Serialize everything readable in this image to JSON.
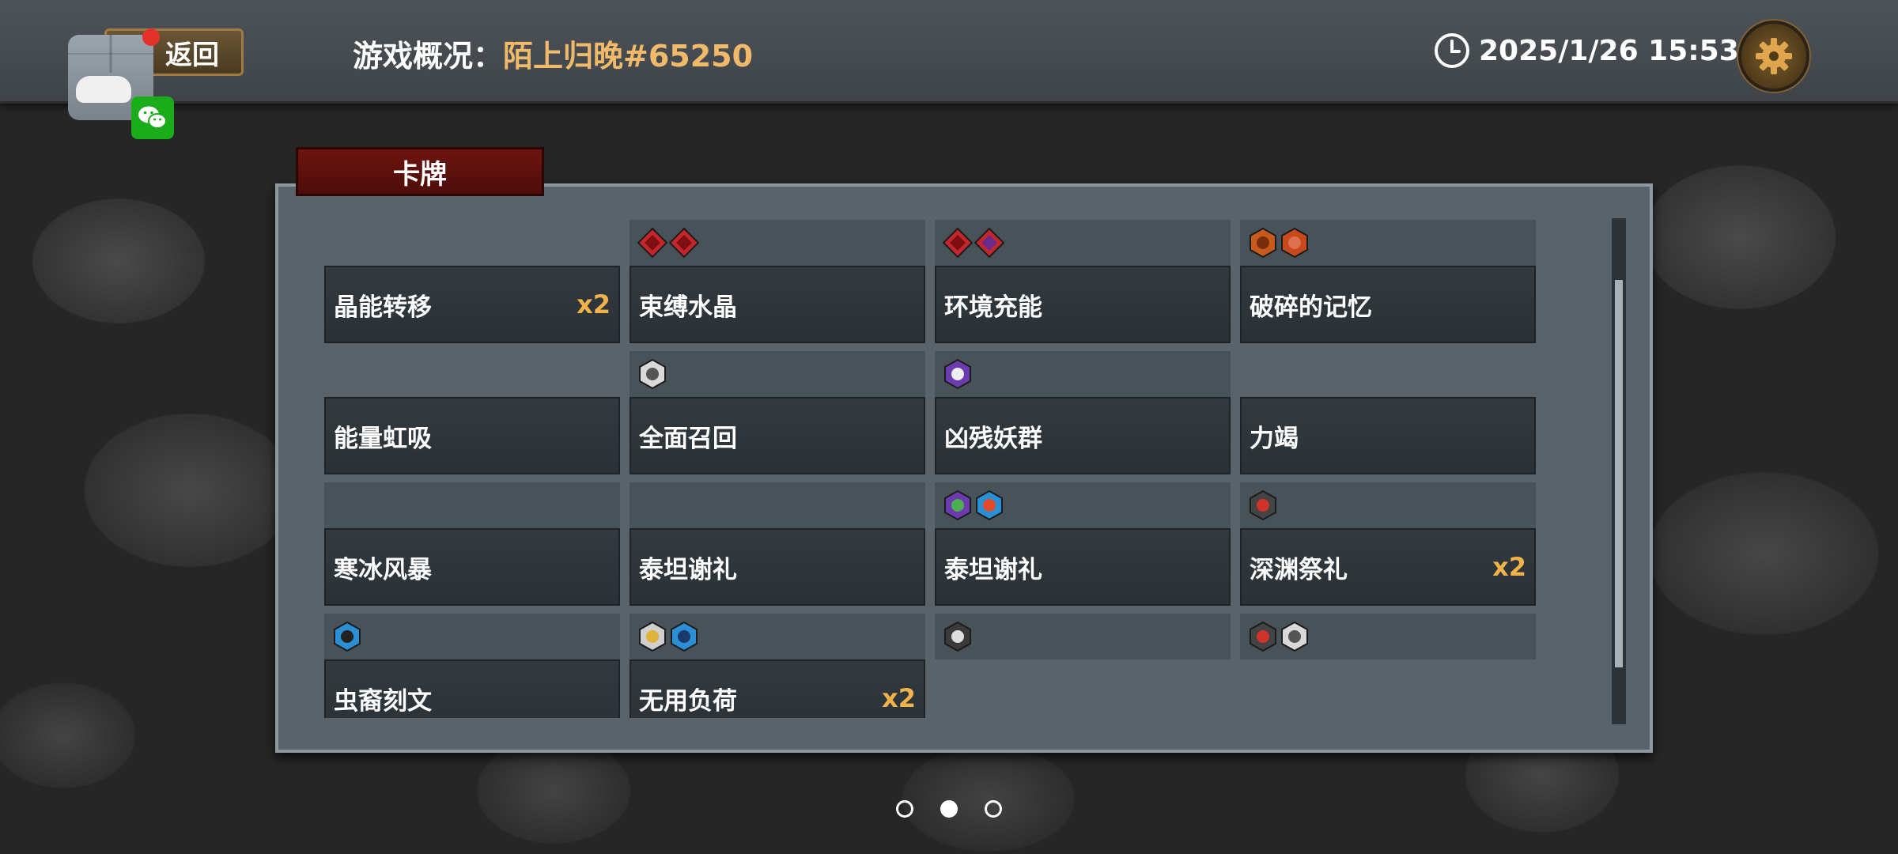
{
  "header": {
    "back_label": "返回",
    "title_label": "游戏概况：",
    "player_name": "陌上归晚#65250",
    "datetime": "2025/1/26 15:53"
  },
  "section": {
    "tab_label": "卡牌"
  },
  "cards": [
    {
      "name": "晶能转移",
      "count": "x2",
      "icons": []
    },
    {
      "name": "束缚水晶",
      "count": "",
      "icons": [
        "red-diamond",
        "red-diamond"
      ]
    },
    {
      "name": "环境充能",
      "count": "",
      "icons": [
        "red-diamond",
        "red-purple-diamond"
      ]
    },
    {
      "name": "破碎的记忆",
      "count": "",
      "icons": [
        "orange-hex",
        "orange-heart-hex"
      ]
    },
    {
      "name": "能量虹吸",
      "count": "",
      "icons": []
    },
    {
      "name": "全面召回",
      "count": "",
      "icons": [
        "gray-eye-hex"
      ]
    },
    {
      "name": "凶残妖群",
      "count": "",
      "icons": [
        "purple-hex"
      ]
    },
    {
      "name": "力竭",
      "count": "",
      "icons": []
    },
    {
      "name": "寒冰风暴",
      "count": "",
      "icons": []
    },
    {
      "name": "泰坦谢礼",
      "count": "",
      "icons": []
    },
    {
      "name": "泰坦谢礼",
      "count": "",
      "icons": [
        "purple-green-hex",
        "blue-fire-hex"
      ]
    },
    {
      "name": "深渊祭礼",
      "count": "x2",
      "icons": [
        "dark-red-hex"
      ]
    },
    {
      "name": "虫裔刻文",
      "count": "",
      "icons": [
        "blue-figure-hex"
      ]
    },
    {
      "name": "无用负荷",
      "count": "x2",
      "icons": [
        "gray-figure-hex",
        "blue-splash-hex"
      ]
    },
    {
      "name": "",
      "count": "",
      "icons": [
        "dark-star-hex"
      ]
    },
    {
      "name": "",
      "count": "",
      "icons": [
        "dark-red-hex",
        "gray-eye-hex"
      ]
    }
  ],
  "pager": {
    "total": 3,
    "active": 2
  },
  "colors": {
    "accent_gold": "#f1ba6b",
    "count_gold": "#f1b24a",
    "tab_red": "#6e1410",
    "panel": "#596369"
  }
}
